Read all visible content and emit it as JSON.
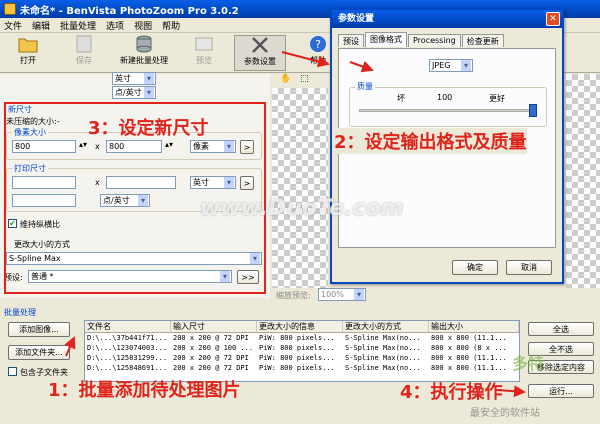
{
  "window": {
    "title": "未命名* - BenVista PhotoZoom Pro 3.0.2"
  },
  "menu": [
    "文件",
    "编辑",
    "批量处理",
    "选项",
    "视图",
    "帮助"
  ],
  "toolbar": {
    "open": "打开",
    "save": "保存",
    "new_batch": "新建批量处理",
    "preview": "预览",
    "settings": "参数设置",
    "help": "帮助"
  },
  "left_panel": {
    "top_select1": "英寸",
    "top_select2": "点/英寸",
    "new_size_label": "新尺寸",
    "uncompressed": "未压缩的大小:-",
    "pixel_size_label": "像素大小",
    "width_px": "800",
    "height_px": "800",
    "unit_px": "像素",
    "times": "x",
    "print_size_label": "打印尺寸",
    "unit_print": "英寸",
    "unit_dpi": "点/英寸",
    "keep_ratio": "维持纵横比",
    "resize_method_label": "更改大小的方式",
    "method": "S-Spline Max",
    "preset_label": "预设:",
    "preset": "普通 *",
    "more_btn": ">>",
    "arrow_btn": ">"
  },
  "preview": {
    "zoom_label": "缩放预览:",
    "zoom_value": "100%"
  },
  "dialog": {
    "title": "参数设置",
    "tabs": [
      "预设",
      "图像格式",
      "Processing",
      "检查更新"
    ],
    "format": "JPEG",
    "quality_label": "质量",
    "quality_low": "坏",
    "quality_value": "100",
    "quality_high": "更好",
    "quality_fraction": 1.0,
    "ok": "确定",
    "cancel": "取消"
  },
  "batch": {
    "label": "批量处理",
    "add_images": "添加图像...",
    "add_folder": "添加文件夹...",
    "include_sub": "包含子文件夹",
    "columns": [
      "文件名",
      "输入尺寸",
      "更改大小的信息",
      "更改大小的方式",
      "输出大小"
    ],
    "rows": [
      [
        "D:\\...\\37b441f71...",
        "200 x 200 @ 72 DPI",
        "PiW: 800 pixels...",
        "S-Spline Max(no...",
        "800 x 800 (11.1..."
      ],
      [
        "D:\\...\\123074003...",
        "200 x 200 @ 100 ...",
        "PiW: 800 pixels...",
        "S-Spline Max(no...",
        "800 x 800 (8 x ..."
      ],
      [
        "D:\\...\\125831299...",
        "200 x 200 @ 72 DPI",
        "PiW: 800 pixels...",
        "S-Spline Max(no...",
        "800 x 800 (11.1..."
      ],
      [
        "D:\\...\\125848691...",
        "200 x 200 @ 72 DPI",
        "PiW: 800 pixels...",
        "S-Spline Max(no...",
        "800 x 800 (11.1..."
      ]
    ],
    "select_all": "全选",
    "select_none": "全不选",
    "remove_selected": "移除选定内容",
    "run": "运行..."
  },
  "annotations": {
    "step1": "1：批量添加待处理图片",
    "step2": "2：设定输出格式及质量",
    "step3": "3：设定新尺寸",
    "step4": "4：执行操作",
    "watermark": "www.DuoTe.com",
    "logo_text": "多特",
    "logo_sub": "最安全的软件站"
  },
  "colors": {
    "annotation": "#e0231b",
    "xp_blue": "#0049c2"
  }
}
